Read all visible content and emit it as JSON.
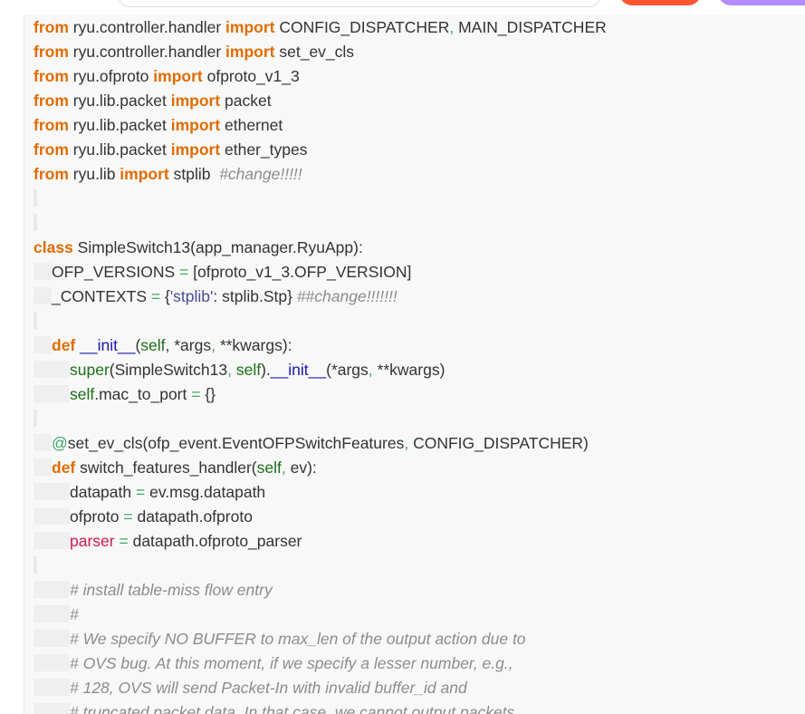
{
  "code": {
    "l1": [
      "from",
      " ryu.controller.handler ",
      "import",
      " CONFIG_DISPATCHER",
      ",",
      " MAIN_DISPATCHER"
    ],
    "l2": [
      "from",
      " ryu.controller.handler ",
      "import",
      " set_ev_cls"
    ],
    "l3": [
      "from",
      " ryu.ofproto ",
      "import",
      " ofproto_v1_3"
    ],
    "l4": [
      "from",
      " ryu.lib.packet ",
      "import",
      " packet"
    ],
    "l5": [
      "from",
      " ryu.lib.packet ",
      "import",
      " ethernet"
    ],
    "l6": [
      "from",
      " ryu.lib.packet ",
      "import",
      " ether_types"
    ],
    "l7": [
      "from",
      " ryu.lib ",
      "import",
      " stplib  ",
      "#change!!!!!"
    ],
    "l10": [
      "class",
      " SimpleSwitch13(app_manager.RyuApp):"
    ],
    "l11": [
      "OFP_VERSIONS ",
      "=",
      " [ofproto_v1_3.OFP_VERSION]"
    ],
    "l12": [
      "_CONTEXTS ",
      "=",
      " {",
      "'stplib'",
      ": stplib.Stp} ",
      "##change!!!!!!!"
    ],
    "l14": [
      "def",
      " ",
      "__init__",
      "(",
      "self",
      ", *args",
      ",",
      " **kwargs):"
    ],
    "l15": [
      "super",
      "(SimpleSwitch13",
      ",",
      " ",
      "self",
      ").",
      "__init__",
      "(*args",
      ",",
      " **kwargs)"
    ],
    "l16": [
      "self",
      ".mac_to_port ",
      "=",
      " {}"
    ],
    "l18": [
      "@",
      "set_ev_cls(ofp_event.EventOFPSwitchFeatures",
      ",",
      " CONFIG_DISPATCHER)"
    ],
    "l19": [
      "def",
      " switch_features_handler(",
      "self",
      ",",
      " ev):"
    ],
    "l20": [
      "datapath ",
      "=",
      " ev.msg.datapath"
    ],
    "l21": [
      "ofproto ",
      "=",
      " datapath.ofproto"
    ],
    "l22": [
      "parser",
      " ",
      "=",
      " datapath.ofproto_parser"
    ],
    "l24": [
      "# install table-miss flow entry"
    ],
    "l25": [
      "#"
    ],
    "l26": [
      "# We specify NO BUFFER to max_len of the output action due to"
    ],
    "l27": [
      "# OVS bug. At this moment, if we specify a lesser number, e.g.,"
    ],
    "l28": [
      "# 128, OVS will send Packet-In with invalid buffer_id and"
    ],
    "l29": [
      "# truncated packet data. In that case, we cannot output packets"
    ]
  }
}
